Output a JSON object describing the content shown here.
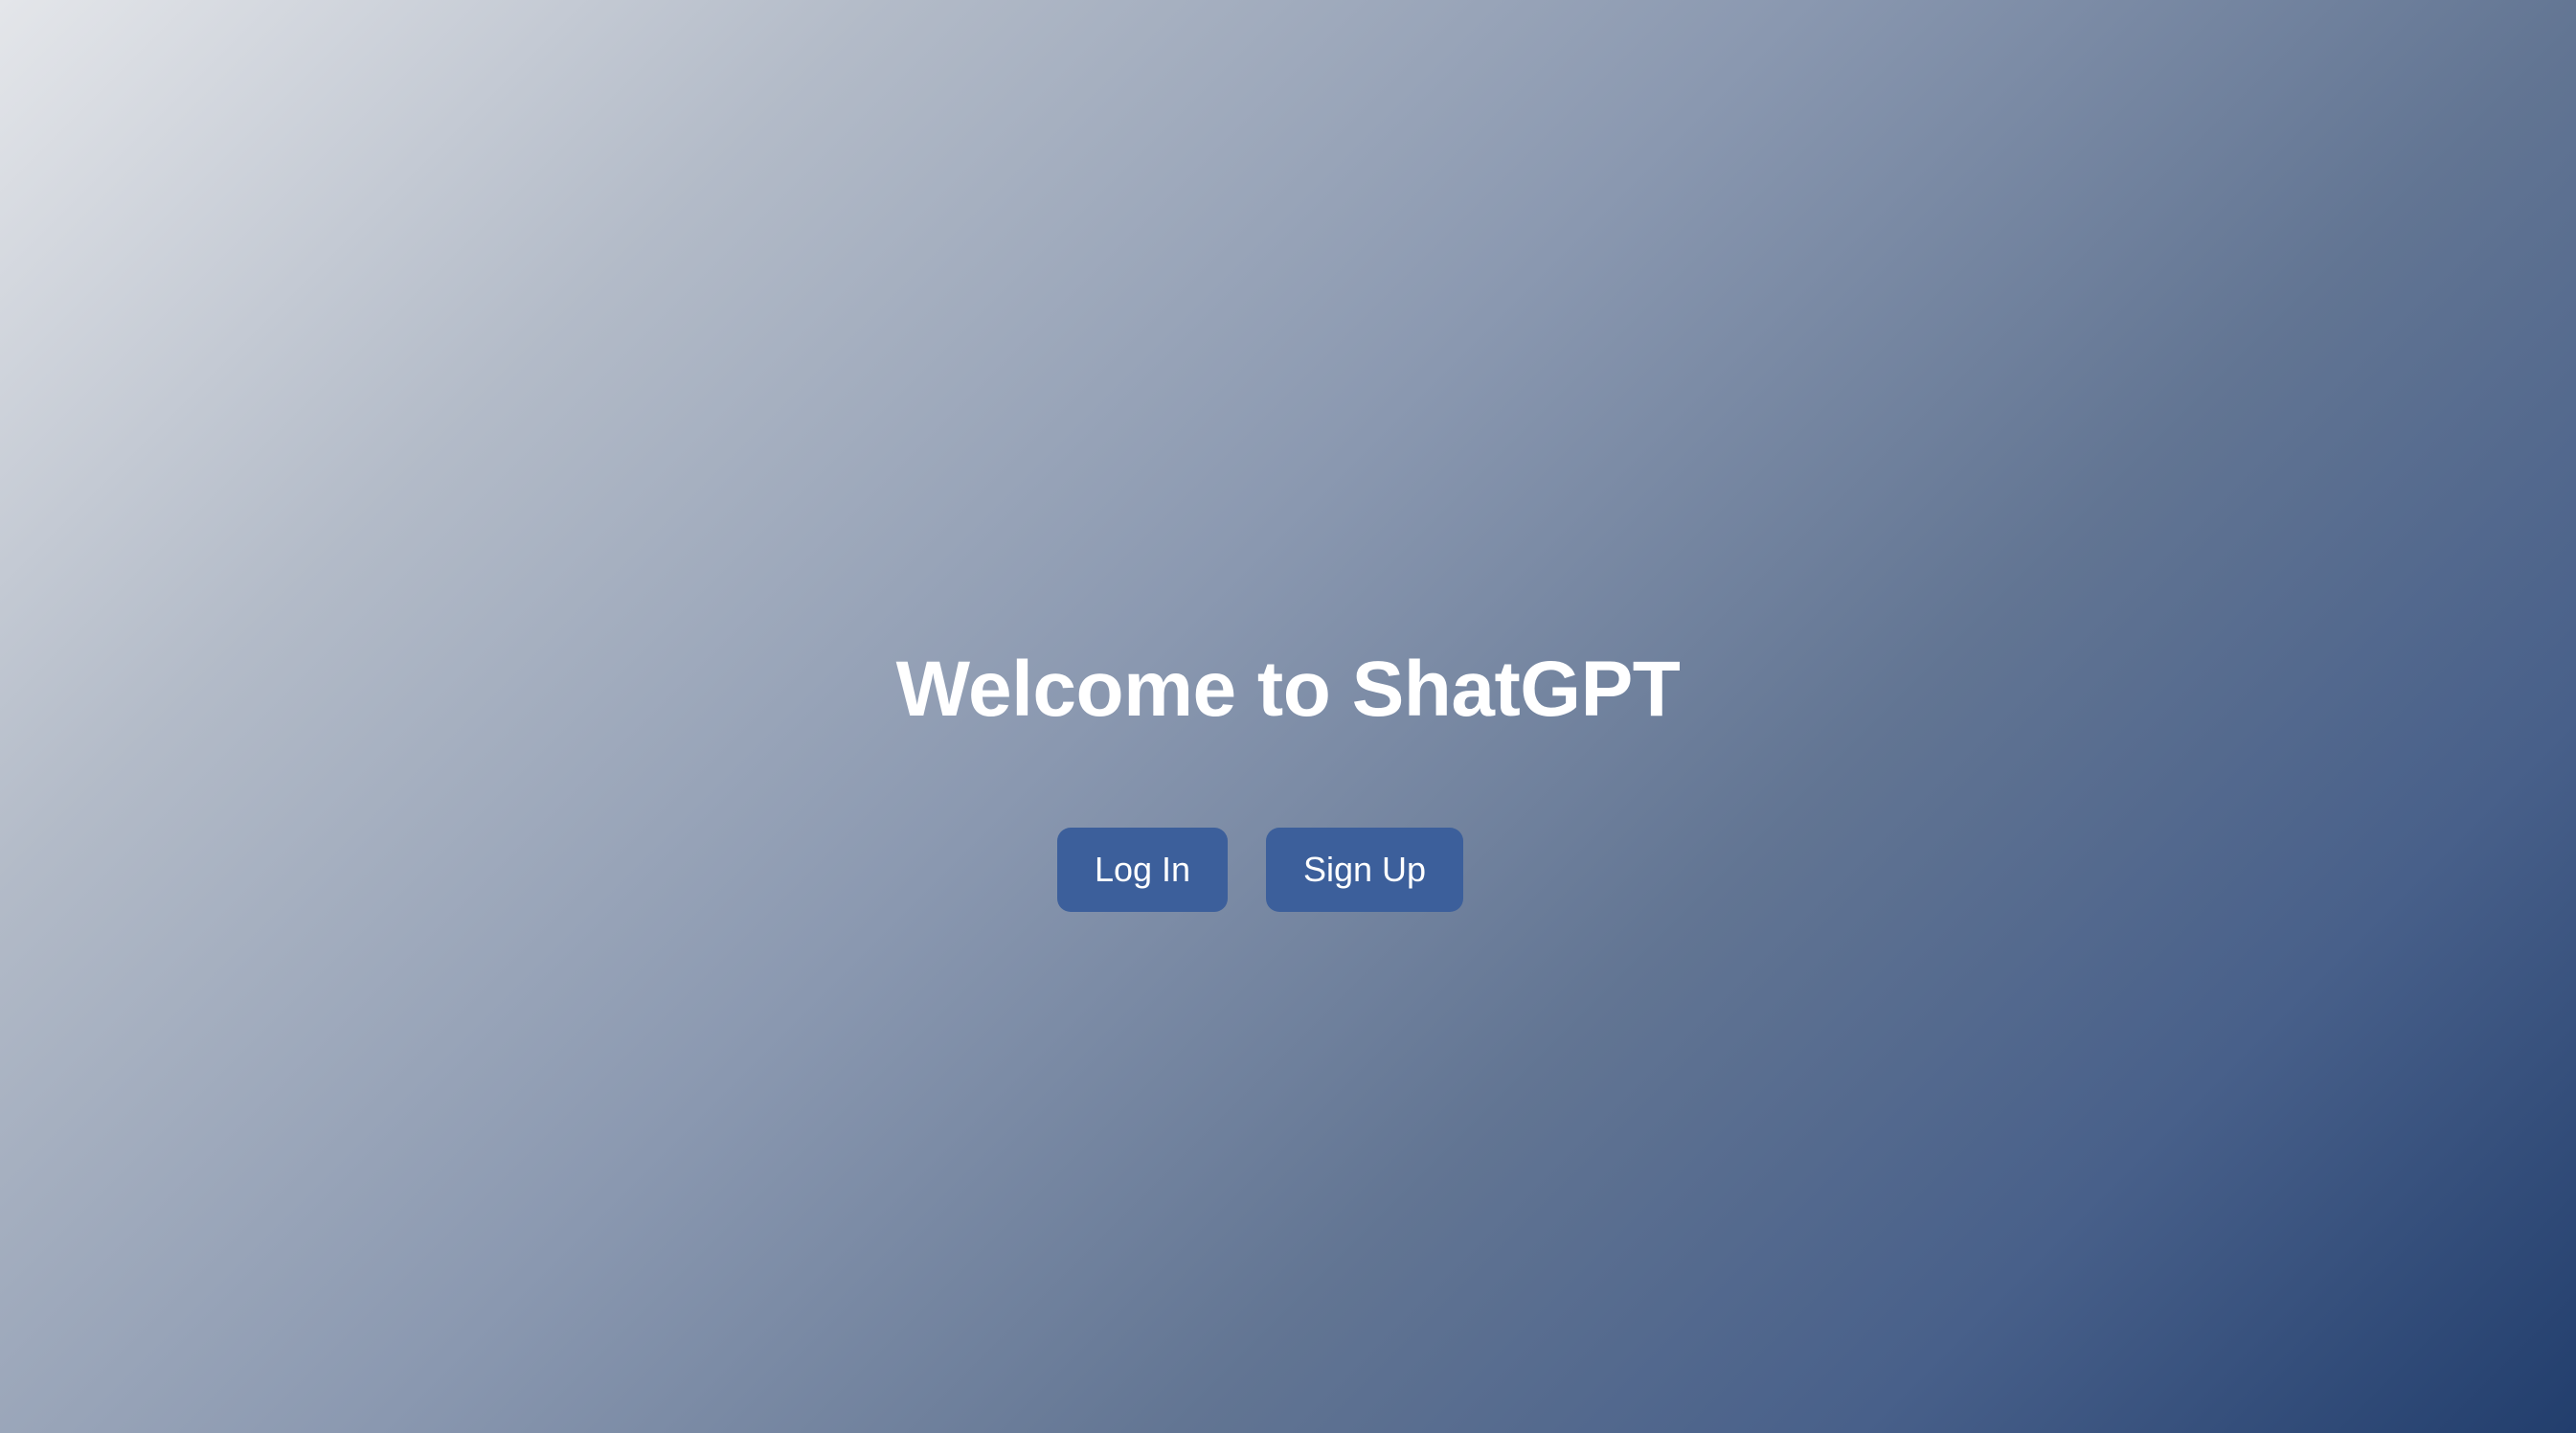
{
  "page": {
    "title": "Welcome to ShatGPT"
  },
  "actions": {
    "login_label": "Log In",
    "signup_label": "Sign Up"
  },
  "colors": {
    "button_bg": "#3c5f9b",
    "button_text": "#ffffff",
    "title_text": "#ffffff",
    "gradient_start": "#e4e6ea",
    "gradient_end": "#223e6d"
  }
}
